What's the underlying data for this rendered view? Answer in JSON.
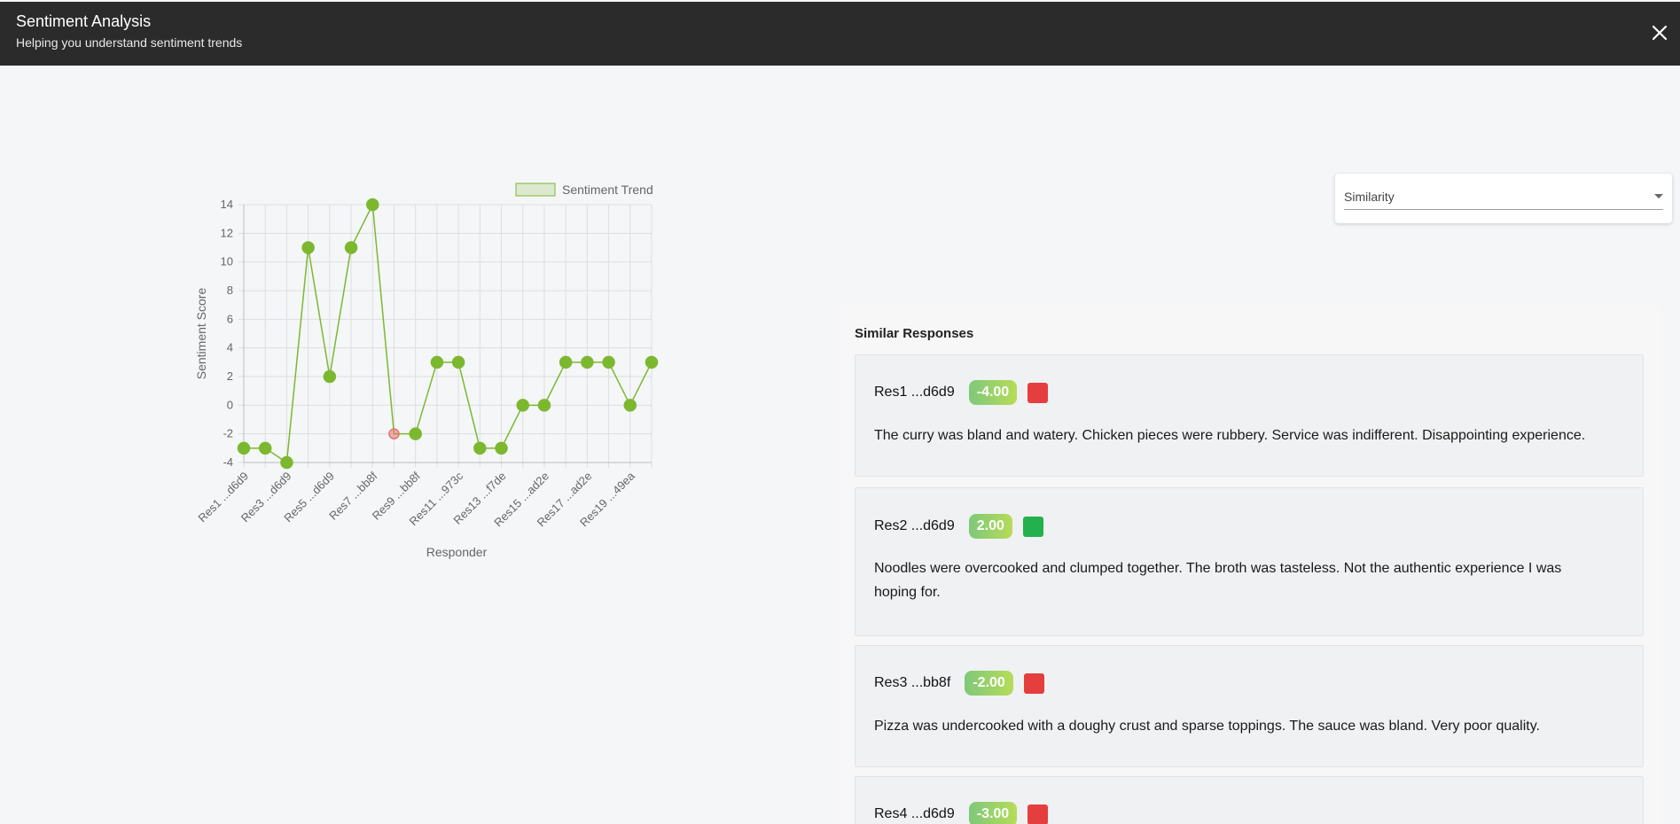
{
  "header": {
    "title": "Sentiment Analysis",
    "subtitle": "Helping you understand sentiment trends"
  },
  "chart_data": {
    "type": "line",
    "legend": "Sentiment Trend",
    "legend_position": "top-right",
    "xlabel": "Responder",
    "ylabel": "Sentiment Score",
    "ylim": [
      -4,
      14
    ],
    "yticks": [
      -4,
      -2,
      0,
      2,
      4,
      6,
      8,
      10,
      12,
      14
    ],
    "grid": true,
    "x_tick_labels": [
      "Res1 ...d6d9",
      "Res3 ...d6d9",
      "Res5 ...d6d9",
      "Res7 ...bb8f",
      "Res9 ...bb8f",
      "Res11 ...973c",
      "Res13 ...f7de",
      "Res15 ...ad2e",
      "Res17 ...ad2e",
      "Res19 ...49ea"
    ],
    "series": [
      {
        "name": "Sentiment Trend",
        "color": "#7cb82f",
        "values": [
          -3,
          -3,
          -4,
          11,
          2,
          11,
          14,
          -2,
          -2,
          3,
          3,
          -3,
          -3,
          0,
          0,
          3,
          3,
          3,
          0,
          3
        ],
        "highlighted_index": 7,
        "highlight_color": "#e57373"
      }
    ]
  },
  "sort_select": {
    "value": "Similarity"
  },
  "similar": {
    "heading": "Similar Responses",
    "items": [
      {
        "name": "Res1 ...d6d9",
        "score": "-4.00",
        "flag_color": "#e53e3e",
        "text": "The curry was bland and watery. Chicken pieces were rubbery. Service was indifferent. Disappointing experience."
      },
      {
        "name": "Res2 ...d6d9",
        "score": "2.00",
        "flag_color": "#22b14c",
        "text": "Noodles were overcooked and clumped together. The broth was tasteless. Not the authentic experience I was hoping for."
      },
      {
        "name": "Res3 ...bb8f",
        "score": "-2.00",
        "flag_color": "#e53e3e",
        "text": "Pizza was undercooked with a doughy crust and sparse toppings. The sauce was bland. Very poor quality."
      },
      {
        "name": "Res4 ...d6d9",
        "score": "-3.00",
        "flag_color": "#e53e3e",
        "text": ""
      }
    ]
  }
}
